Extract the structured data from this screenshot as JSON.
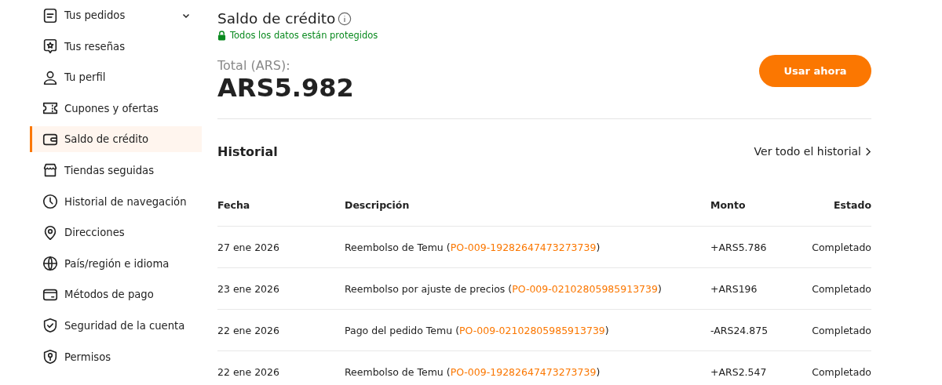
{
  "sidebar": {
    "items": [
      {
        "label": "Tus pedidos",
        "selected": false,
        "expandable": true
      },
      {
        "label": "Tus reseñas",
        "selected": false
      },
      {
        "label": "Tu perfil",
        "selected": false
      },
      {
        "label": "Cupones y ofertas",
        "selected": false
      },
      {
        "label": "Saldo de crédito",
        "selected": true
      },
      {
        "label": "Tiendas seguidas",
        "selected": false
      },
      {
        "label": "Historial de navegación",
        "selected": false
      },
      {
        "label": "Direcciones",
        "selected": false
      },
      {
        "label": "País/región e idioma",
        "selected": false
      },
      {
        "label": "Métodos de pago",
        "selected": false
      },
      {
        "label": "Seguridad de la cuenta",
        "selected": false
      },
      {
        "label": "Permisos",
        "selected": false
      }
    ]
  },
  "header": {
    "title": "Saldo de crédito",
    "secure_note": "Todos los datos están protegidos"
  },
  "balance": {
    "label": "Total (ARS):",
    "amount": "ARS5.982",
    "button": "Usar ahora"
  },
  "history": {
    "title": "Historial",
    "view_all": "Ver todo el historial",
    "columns": [
      "Fecha",
      "Descripción",
      "Monto",
      "Estado"
    ],
    "rows": [
      {
        "date": "27 ene 2026",
        "text": "Reembolso de Temu (",
        "order": "PO-009-19282647473273739",
        "close": ")",
        "amount": "+ARS5.786",
        "status": "Completado"
      },
      {
        "date": "23 ene 2026",
        "text": "Reembolso por ajuste de precios (",
        "order": "PO-009-02102805985913739",
        "close": ")",
        "amount": "+ARS196",
        "status": "Completado"
      },
      {
        "date": "22 ene 2026",
        "text": "Pago del pedido Temu (",
        "order": "PO-009-02102805985913739",
        "close": ")",
        "amount": "-ARS24.875",
        "status": "Completado"
      },
      {
        "date": "22 ene 2026",
        "text": "Reembolso de Temu (",
        "order": "PO-009-19282647473273739",
        "close": ")",
        "amount": "+ARS2.547",
        "status": "Completado"
      }
    ]
  }
}
